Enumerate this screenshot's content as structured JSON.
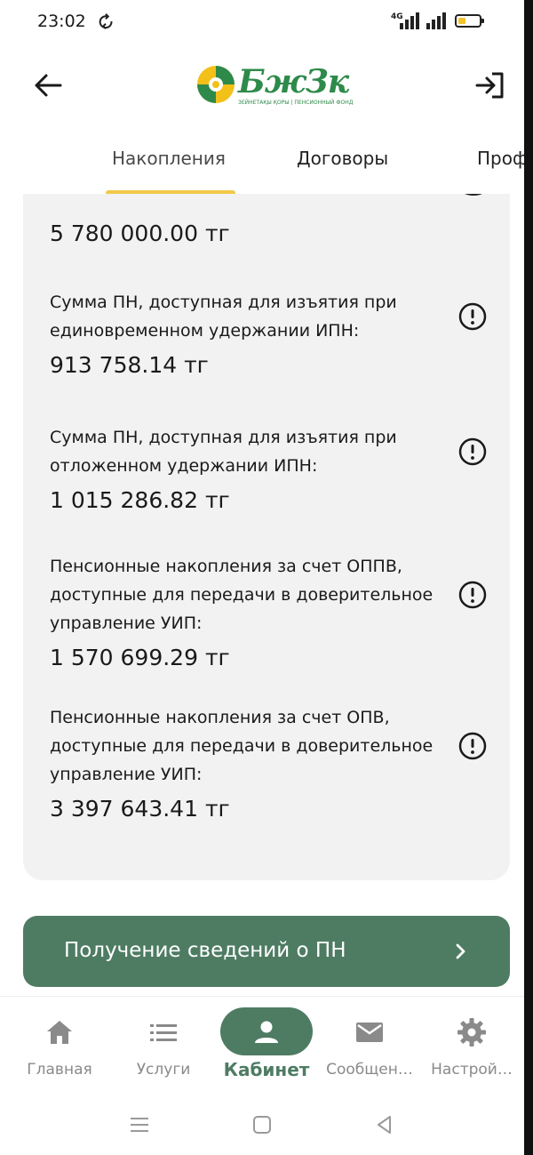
{
  "status_bar": {
    "time": "23:02",
    "network": "4G",
    "battery_level": 0.35,
    "battery_color": "#f4c430"
  },
  "header": {
    "back_icon": "arrow-left-icon",
    "logo_text": "БжЗк",
    "logo_sub": "ЗЕЙНЕТАҚЫ ҚОРЫ | ПЕНСИОННЫЙ ФОНД",
    "exit_icon": "logout-icon"
  },
  "tabs": [
    {
      "label": "Накопления",
      "active": true
    },
    {
      "label": "Договоры",
      "active": false
    },
    {
      "label": "Проф",
      "active": false
    }
  ],
  "card": {
    "top_amount": "5 780 000.00 тг",
    "items": [
      {
        "label": "Сумма ПН, доступная для изъятия при единовременном удержании ИПН:",
        "value": "913 758.14 тг"
      },
      {
        "label": "Сумма ПН, доступная для изъятия при отложенном удержании ИПН:",
        "value": "1 015 286.82 тг"
      },
      {
        "label": "Пенсионные накопления за счет ОППВ, доступные для передачи в доверительное управление УИП:",
        "value": "1 570 699.29 тг"
      },
      {
        "label": "Пенсионные накопления за счет ОПВ, доступные для передачи в доверительное управление УИП:",
        "value": "3 397 643.41 тг"
      }
    ]
  },
  "action_button": {
    "label": "Получение сведений о ПН",
    "icon": "chevron-right-icon"
  },
  "bottom_nav": [
    {
      "label": "Главная",
      "icon": "home-icon",
      "active": false
    },
    {
      "label": "Услуги",
      "icon": "list-icon",
      "active": false
    },
    {
      "label": "Кабинет",
      "icon": "person-icon",
      "active": true
    },
    {
      "label": "Сообщен…",
      "icon": "mail-icon",
      "active": false
    },
    {
      "label": "Настрой…",
      "icon": "gear-icon",
      "active": false
    }
  ],
  "colors": {
    "accent": "#4e7c63",
    "tab_indicator": "#f1c94a",
    "card_bg": "#f2f2f2",
    "logo_green": "#2e8a4a"
  }
}
